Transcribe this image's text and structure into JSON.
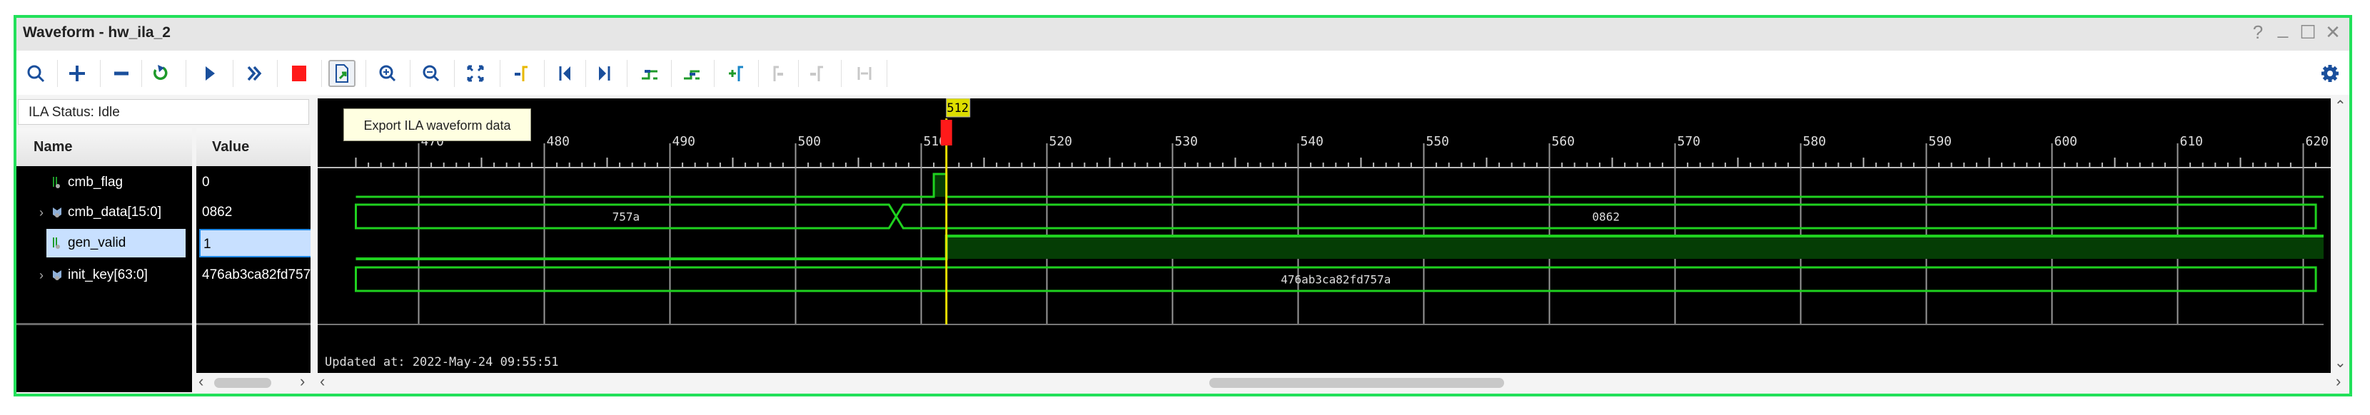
{
  "window": {
    "title": "Waveform - hw_ila_2",
    "controls": {
      "help": "?",
      "minimize": "_",
      "maximize": "☐",
      "close": "✕"
    }
  },
  "toolbar": {
    "buttons": [
      {
        "name": "search",
        "icon": "search-icon"
      },
      {
        "name": "add",
        "icon": "plus-icon"
      },
      {
        "name": "remove",
        "icon": "minus-icon"
      },
      {
        "name": "run-trigger-immediate",
        "icon": "refresh-arrow-icon"
      },
      {
        "name": "run-trigger",
        "icon": "play-icon"
      },
      {
        "name": "auto-retrigger",
        "icon": "double-chevron-icon"
      },
      {
        "name": "stop",
        "icon": "stop-icon"
      },
      {
        "name": "export-waveform",
        "icon": "export-icon"
      },
      {
        "name": "zoom-in",
        "icon": "zoom-in-icon"
      },
      {
        "name": "zoom-out",
        "icon": "zoom-out-icon"
      },
      {
        "name": "zoom-fit",
        "icon": "zoom-fit-icon"
      },
      {
        "name": "go-to-cursor",
        "icon": "cursor-icon"
      },
      {
        "name": "go-to-time-0",
        "icon": "skip-start-icon"
      },
      {
        "name": "go-to-last-time",
        "icon": "skip-end-icon"
      },
      {
        "name": "previous-transition",
        "icon": "prev-transition-icon"
      },
      {
        "name": "next-transition",
        "icon": "next-transition-icon"
      },
      {
        "name": "add-marker",
        "icon": "add-marker-icon"
      },
      {
        "name": "previous-marker",
        "icon": "prev-marker-icon",
        "disabled": true
      },
      {
        "name": "next-marker",
        "icon": "next-marker-icon",
        "disabled": true
      },
      {
        "name": "swap-cursors",
        "icon": "swap-icon",
        "disabled": true
      }
    ],
    "settings_icon": "gear-icon",
    "tooltip": "Export ILA waveform data"
  },
  "status": "ILA Status: Idle",
  "columns": {
    "name": "Name",
    "value": "Value"
  },
  "signals": [
    {
      "name": "cmb_flag",
      "value": "0",
      "type": "bit",
      "expandable": false,
      "selected": false,
      "initial": 0,
      "transitions": [
        {
          "t": 511,
          "v": 1
        },
        {
          "t": 512,
          "v": 0
        }
      ]
    },
    {
      "name": "cmb_data[15:0]",
      "value": "0862",
      "type": "bus",
      "expandable": true,
      "selected": false,
      "segments": [
        {
          "from": 465,
          "to": 508,
          "label": "757a"
        },
        {
          "from": 508,
          "to": 621,
          "label": "0862"
        }
      ]
    },
    {
      "name": "gen_valid",
      "value": "1",
      "type": "bit",
      "expandable": false,
      "selected": true,
      "initial": 0,
      "transitions": [
        {
          "t": 512,
          "v": 1
        }
      ]
    },
    {
      "name": "init_key[63:0]",
      "value": "476ab3ca82fd757a",
      "type": "bus",
      "expandable": true,
      "selected": false,
      "segments": [
        {
          "from": 465,
          "to": 621,
          "label": "476ab3ca82fd757a"
        }
      ]
    }
  ],
  "timeline": {
    "start": 465,
    "end": 621,
    "major_step": 10,
    "labels": [
      "470",
      "480",
      "490",
      "500",
      "510",
      "520",
      "530",
      "540",
      "550",
      "560",
      "570",
      "580",
      "590",
      "600",
      "610",
      "620"
    ]
  },
  "cursor": {
    "position": 512,
    "label": "512"
  },
  "updated_at": "Updated at: 2022-May-24 09:55:51",
  "colors": {
    "accent_frame": "#22e05a",
    "wave": "#1fd11f",
    "cursor": "#e8e000",
    "marker": "#ff1a1a"
  }
}
